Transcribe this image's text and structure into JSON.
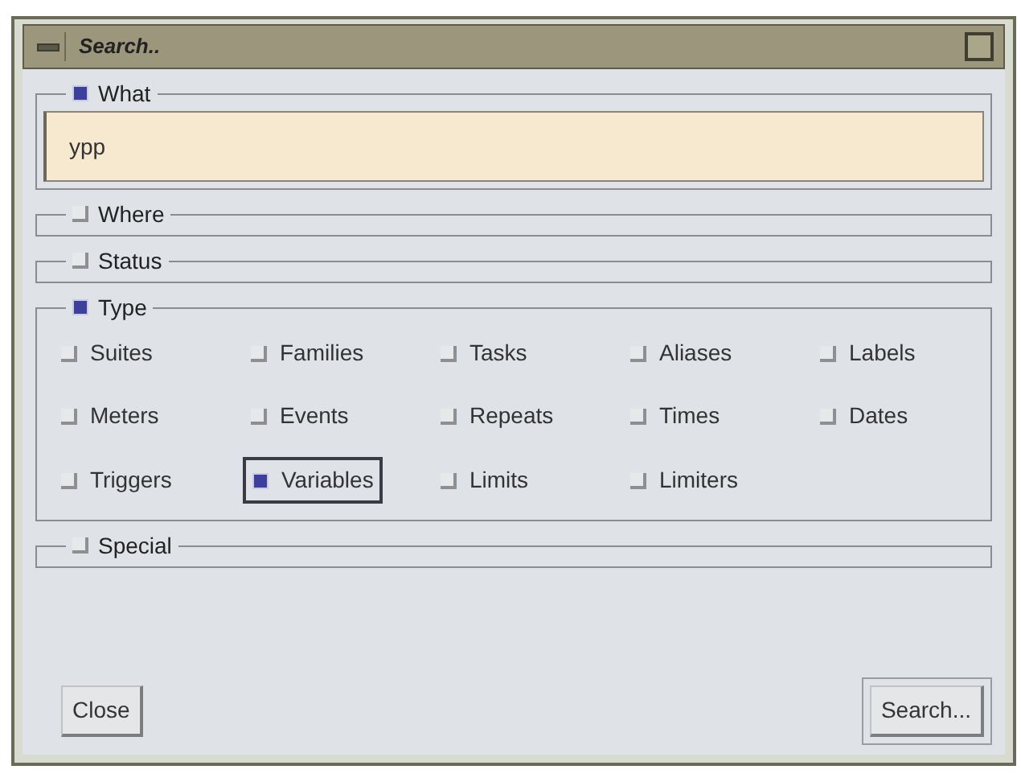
{
  "window": {
    "title": "Search.."
  },
  "sections": [
    {
      "kind": "text",
      "label": "What",
      "checked": true,
      "value": "ypp"
    },
    {
      "kind": "empty",
      "label": "Where",
      "checked": false
    },
    {
      "kind": "empty",
      "label": "Status",
      "checked": false
    },
    {
      "kind": "options",
      "label": "Type",
      "checked": true,
      "options": [
        {
          "label": "Suites",
          "checked": false,
          "focused": false
        },
        {
          "label": "Families",
          "checked": false,
          "focused": false
        },
        {
          "label": "Tasks",
          "checked": false,
          "focused": false
        },
        {
          "label": "Aliases",
          "checked": false,
          "focused": false
        },
        {
          "label": "Labels",
          "checked": false,
          "focused": false
        },
        {
          "label": "Meters",
          "checked": false,
          "focused": false
        },
        {
          "label": "Events",
          "checked": false,
          "focused": false
        },
        {
          "label": "Repeats",
          "checked": false,
          "focused": false
        },
        {
          "label": "Times",
          "checked": false,
          "focused": false
        },
        {
          "label": "Dates",
          "checked": false,
          "focused": false
        },
        {
          "label": "Triggers",
          "checked": false,
          "focused": false
        },
        {
          "label": "Variables",
          "checked": true,
          "focused": true
        },
        {
          "label": "Limits",
          "checked": false,
          "focused": false
        },
        {
          "label": "Limiters",
          "checked": false,
          "focused": false
        }
      ]
    },
    {
      "kind": "empty",
      "label": "Special",
      "checked": false
    }
  ],
  "buttons": [
    {
      "label": "Close",
      "default": false
    },
    {
      "label": "Search...",
      "default": true
    }
  ]
}
